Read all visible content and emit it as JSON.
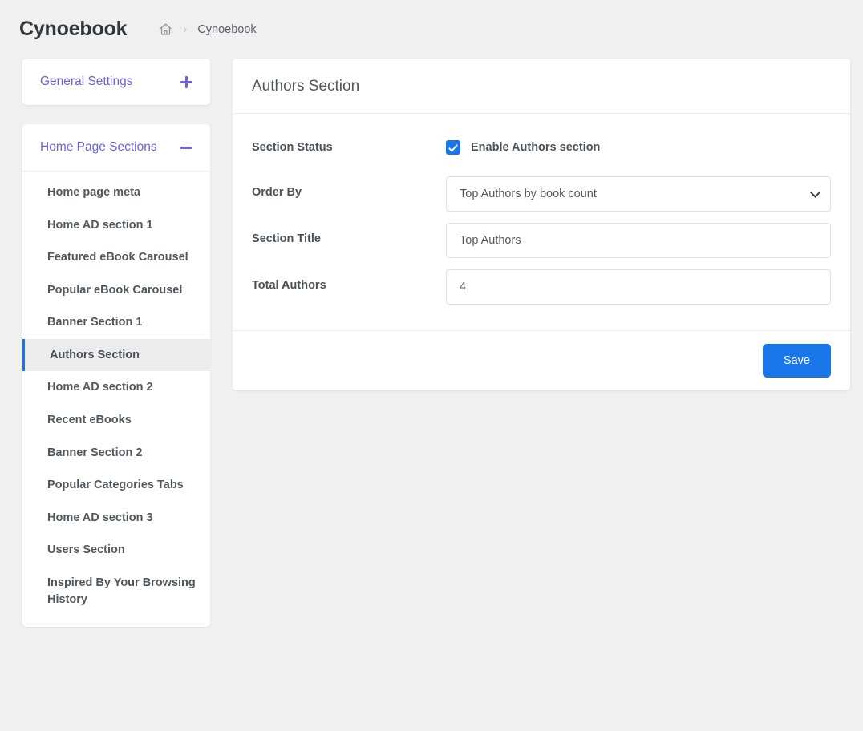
{
  "header": {
    "brand": "Cynoebook",
    "breadcrumb": {
      "home_icon": "home-icon",
      "separator": "›",
      "current": "Cynoebook"
    }
  },
  "sidebar": {
    "panels": [
      {
        "title": "General Settings",
        "toggle_icon": "plus-icon",
        "expanded": false,
        "items": []
      },
      {
        "title": "Home Page Sections",
        "toggle_icon": "minus-icon",
        "expanded": true,
        "items": [
          {
            "label": "Home page meta",
            "active": false
          },
          {
            "label": "Home AD section 1",
            "active": false
          },
          {
            "label": "Featured eBook Carousel",
            "active": false
          },
          {
            "label": "Popular eBook Carousel",
            "active": false
          },
          {
            "label": "Banner Section 1",
            "active": false
          },
          {
            "label": "Authors Section",
            "active": true
          },
          {
            "label": "Home AD section 2",
            "active": false
          },
          {
            "label": "Recent eBooks",
            "active": false
          },
          {
            "label": "Banner Section 2",
            "active": false
          },
          {
            "label": "Popular Categories Tabs",
            "active": false
          },
          {
            "label": "Home AD section 3",
            "active": false
          },
          {
            "label": "Users Section",
            "active": false
          },
          {
            "label": "Inspired By Your Browsing History",
            "active": false
          }
        ]
      }
    ]
  },
  "main": {
    "card_title": "Authors Section",
    "fields": {
      "section_status": {
        "label": "Section Status",
        "checkbox_label": "Enable Authors section",
        "checked": true
      },
      "order_by": {
        "label": "Order By",
        "value": "Top Authors by book count",
        "chevron_icon": "chevron-down-icon"
      },
      "section_title": {
        "label": "Section Title",
        "value": "Top Authors",
        "placeholder": "Section Title"
      },
      "total_authors": {
        "label": "Total Authors",
        "value": "4",
        "placeholder": "Total Authors"
      }
    },
    "save_label": "Save"
  },
  "colors": {
    "accent_blue": "#1876e8",
    "accent_purple": "#6a63de",
    "page_bg": "#f0f0f0"
  }
}
